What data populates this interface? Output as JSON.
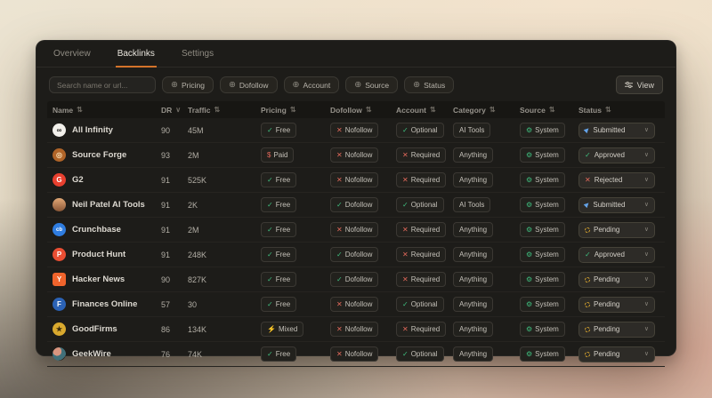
{
  "tabs": [
    {
      "label": "Overview",
      "active": false
    },
    {
      "label": "Backlinks",
      "active": true
    },
    {
      "label": "Settings",
      "active": false
    }
  ],
  "toolbar": {
    "search_placeholder": "Search name or url...",
    "filters": [
      {
        "label": "Pricing",
        "icon": "plus-circle"
      },
      {
        "label": "Dofollow",
        "icon": "plus-circle"
      },
      {
        "label": "Account",
        "icon": "plus-circle"
      },
      {
        "label": "Source",
        "icon": "plus-circle"
      },
      {
        "label": "Status",
        "icon": "plus-circle"
      }
    ],
    "view_label": "View",
    "view_icon": "sliders"
  },
  "table": {
    "columns": [
      {
        "label": "Name",
        "sort": "both"
      },
      {
        "label": "DR",
        "sort": "desc"
      },
      {
        "label": "Traffic",
        "sort": "both"
      },
      {
        "label": "Pricing",
        "sort": "both"
      },
      {
        "label": "Dofollow",
        "sort": "both"
      },
      {
        "label": "Account",
        "sort": "both"
      },
      {
        "label": "Category",
        "sort": "both"
      },
      {
        "label": "Source",
        "sort": "both"
      },
      {
        "label": "Status",
        "sort": "both"
      }
    ],
    "rows": [
      {
        "name": "All Infinity",
        "icon": {
          "text": "∞",
          "bg": "#f2f0eb",
          "fg": "#1d1c1a"
        },
        "dr": "90",
        "traffic": "45M",
        "pricing": {
          "label": "Free",
          "icon": "check"
        },
        "dofollow": {
          "label": "Nofollow",
          "icon": "cross"
        },
        "account": {
          "label": "Optional",
          "icon": "check"
        },
        "category": "AI Tools",
        "source": {
          "label": "System",
          "icon": "gear"
        },
        "status": {
          "label": "Submitted",
          "icon": "send"
        }
      },
      {
        "name": "Source Forge",
        "icon": {
          "text": "◎",
          "bg": "#b06428",
          "fg": "#f7ddb4"
        },
        "dr": "93",
        "traffic": "2M",
        "pricing": {
          "label": "Paid",
          "icon": "dollar"
        },
        "dofollow": {
          "label": "Nofollow",
          "icon": "cross"
        },
        "account": {
          "label": "Required",
          "icon": "cross"
        },
        "category": "Anything",
        "source": {
          "label": "System",
          "icon": "gear"
        },
        "status": {
          "label": "Approved",
          "icon": "check"
        }
      },
      {
        "name": "G2",
        "icon": {
          "text": "G",
          "bg": "#e8402f",
          "fg": "#ffffff"
        },
        "dr": "91",
        "traffic": "525K",
        "pricing": {
          "label": "Free",
          "icon": "check"
        },
        "dofollow": {
          "label": "Nofollow",
          "icon": "cross"
        },
        "account": {
          "label": "Required",
          "icon": "cross"
        },
        "category": "Anything",
        "source": {
          "label": "System",
          "icon": "gear"
        },
        "status": {
          "label": "Rejected",
          "icon": "cross"
        }
      },
      {
        "name": "Neil Patel AI Tools",
        "icon": {
          "text": "",
          "bg": "linear-gradient(180deg,#e2a876,#8a5636)",
          "fg": "#ffffff"
        },
        "dr": "91",
        "traffic": "2K",
        "pricing": {
          "label": "Free",
          "icon": "check"
        },
        "dofollow": {
          "label": "Dofollow",
          "icon": "check"
        },
        "account": {
          "label": "Optional",
          "icon": "check"
        },
        "category": "AI Tools",
        "source": {
          "label": "System",
          "icon": "gear"
        },
        "status": {
          "label": "Submitted",
          "icon": "send"
        }
      },
      {
        "name": "Crunchbase",
        "icon": {
          "text": "cb",
          "bg": "#2f7de1",
          "fg": "#ffffff"
        },
        "dr": "91",
        "traffic": "2M",
        "pricing": {
          "label": "Free",
          "icon": "check"
        },
        "dofollow": {
          "label": "Nofollow",
          "icon": "cross"
        },
        "account": {
          "label": "Required",
          "icon": "cross"
        },
        "category": "Anything",
        "source": {
          "label": "System",
          "icon": "gear"
        },
        "status": {
          "label": "Pending",
          "icon": "pending"
        }
      },
      {
        "name": "Product Hunt",
        "icon": {
          "text": "P",
          "bg": "#ea4e33",
          "fg": "#ffffff"
        },
        "dr": "91",
        "traffic": "248K",
        "pricing": {
          "label": "Free",
          "icon": "check"
        },
        "dofollow": {
          "label": "Dofollow",
          "icon": "check"
        },
        "account": {
          "label": "Required",
          "icon": "cross"
        },
        "category": "Anything",
        "source": {
          "label": "System",
          "icon": "gear"
        },
        "status": {
          "label": "Approved",
          "icon": "check"
        }
      },
      {
        "name": "Hacker News",
        "icon": {
          "text": "Y",
          "bg": "#f0642c",
          "fg": "#ffffff",
          "shape": "square"
        },
        "dr": "90",
        "traffic": "827K",
        "pricing": {
          "label": "Free",
          "icon": "check"
        },
        "dofollow": {
          "label": "Dofollow",
          "icon": "check"
        },
        "account": {
          "label": "Required",
          "icon": "cross"
        },
        "category": "Anything",
        "source": {
          "label": "System",
          "icon": "gear"
        },
        "status": {
          "label": "Pending",
          "icon": "pending"
        }
      },
      {
        "name": "Finances Online",
        "icon": {
          "text": "F",
          "bg": "#2b62b5",
          "fg": "#ffffff"
        },
        "dr": "57",
        "traffic": "30",
        "pricing": {
          "label": "Free",
          "icon": "check"
        },
        "dofollow": {
          "label": "Nofollow",
          "icon": "cross"
        },
        "account": {
          "label": "Optional",
          "icon": "check"
        },
        "category": "Anything",
        "source": {
          "label": "System",
          "icon": "gear"
        },
        "status": {
          "label": "Pending",
          "icon": "pending"
        }
      },
      {
        "name": "GoodFirms",
        "icon": {
          "text": "★",
          "bg": "#d9a92e",
          "fg": "#3a2c10"
        },
        "dr": "86",
        "traffic": "134K",
        "pricing": {
          "label": "Mixed",
          "icon": "bolt"
        },
        "dofollow": {
          "label": "Nofollow",
          "icon": "cross"
        },
        "account": {
          "label": "Required",
          "icon": "cross"
        },
        "category": "Anything",
        "source": {
          "label": "System",
          "icon": "gear"
        },
        "status": {
          "label": "Pending",
          "icon": "pending"
        }
      },
      {
        "name": "GeekWire",
        "icon": {
          "text": "",
          "bg": "radial-gradient(circle at 35% 30%,#d9957f 0 34%,#41707a 35% 72%,#2b2620 73%)",
          "fg": "#ffffff"
        },
        "dr": "76",
        "traffic": "74K",
        "pricing": {
          "label": "Free",
          "icon": "check"
        },
        "dofollow": {
          "label": "Nofollow",
          "icon": "cross"
        },
        "account": {
          "label": "Optional",
          "icon": "check"
        },
        "category": "Anything",
        "source": {
          "label": "System",
          "icon": "gear"
        },
        "status": {
          "label": "Pending",
          "icon": "pending"
        }
      }
    ]
  },
  "colors": {
    "accent_orange": "#d4732a",
    "green": "#3fbf7f",
    "red": "#e0685a",
    "yellow": "#d9a62e",
    "blue": "#64a3e8",
    "card_bg": "#1d1c19"
  }
}
